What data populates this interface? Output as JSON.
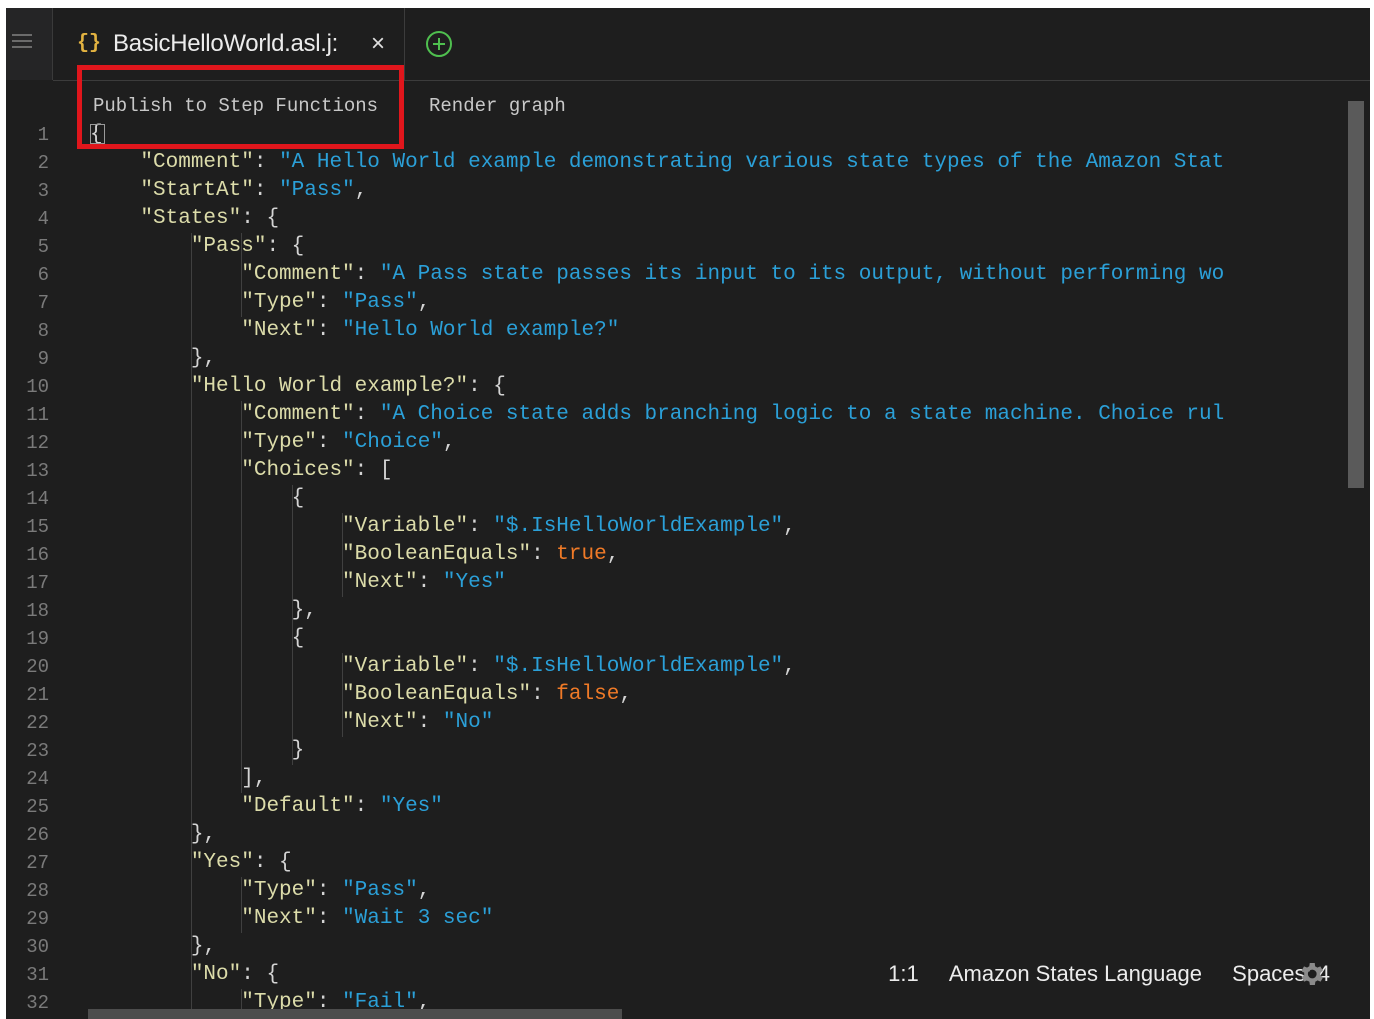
{
  "tab": {
    "icon": "{}",
    "title": "BasicHelloWorld.asl.j:",
    "close": "×"
  },
  "codelens": {
    "publish": "Publish to Step Functions",
    "render": "Render graph"
  },
  "line_numbers": [
    "1",
    "2",
    "3",
    "4",
    "5",
    "6",
    "7",
    "8",
    "9",
    "10",
    "11",
    "12",
    "13",
    "14",
    "15",
    "16",
    "17",
    "18",
    "19",
    "20",
    "21",
    "22",
    "23",
    "24",
    "25",
    "26",
    "27",
    "28",
    "29",
    "30",
    "31",
    "32"
  ],
  "code_lines": [
    [
      {
        "t": "p",
        "v": "{"
      }
    ],
    [
      {
        "t": "p",
        "v": "    "
      },
      {
        "t": "k",
        "v": "\"Comment\""
      },
      {
        "t": "p",
        "v": ": "
      },
      {
        "t": "s",
        "v": "\"A Hello World example demonstrating various state types of the Amazon Stat"
      }
    ],
    [
      {
        "t": "p",
        "v": "    "
      },
      {
        "t": "k",
        "v": "\"StartAt\""
      },
      {
        "t": "p",
        "v": ": "
      },
      {
        "t": "s",
        "v": "\"Pass\""
      },
      {
        "t": "p",
        "v": ","
      }
    ],
    [
      {
        "t": "p",
        "v": "    "
      },
      {
        "t": "k",
        "v": "\"States\""
      },
      {
        "t": "p",
        "v": ": {"
      }
    ],
    [
      {
        "t": "p",
        "v": "        "
      },
      {
        "t": "k",
        "v": "\"Pass\""
      },
      {
        "t": "p",
        "v": ": {"
      }
    ],
    [
      {
        "t": "p",
        "v": "            "
      },
      {
        "t": "k",
        "v": "\"Comment\""
      },
      {
        "t": "p",
        "v": ": "
      },
      {
        "t": "s",
        "v": "\"A Pass state passes its input to its output, without performing wo"
      }
    ],
    [
      {
        "t": "p",
        "v": "            "
      },
      {
        "t": "k",
        "v": "\"Type\""
      },
      {
        "t": "p",
        "v": ": "
      },
      {
        "t": "s",
        "v": "\"Pass\""
      },
      {
        "t": "p",
        "v": ","
      }
    ],
    [
      {
        "t": "p",
        "v": "            "
      },
      {
        "t": "k",
        "v": "\"Next\""
      },
      {
        "t": "p",
        "v": ": "
      },
      {
        "t": "s",
        "v": "\"Hello World example?\""
      }
    ],
    [
      {
        "t": "p",
        "v": "        },"
      }
    ],
    [
      {
        "t": "p",
        "v": "        "
      },
      {
        "t": "k",
        "v": "\"Hello World example?\""
      },
      {
        "t": "p",
        "v": ": {"
      }
    ],
    [
      {
        "t": "p",
        "v": "            "
      },
      {
        "t": "k",
        "v": "\"Comment\""
      },
      {
        "t": "p",
        "v": ": "
      },
      {
        "t": "s",
        "v": "\"A Choice state adds branching logic to a state machine. Choice rul"
      }
    ],
    [
      {
        "t": "p",
        "v": "            "
      },
      {
        "t": "k",
        "v": "\"Type\""
      },
      {
        "t": "p",
        "v": ": "
      },
      {
        "t": "s",
        "v": "\"Choice\""
      },
      {
        "t": "p",
        "v": ","
      }
    ],
    [
      {
        "t": "p",
        "v": "            "
      },
      {
        "t": "k",
        "v": "\"Choices\""
      },
      {
        "t": "p",
        "v": ": ["
      }
    ],
    [
      {
        "t": "p",
        "v": "                {"
      }
    ],
    [
      {
        "t": "p",
        "v": "                    "
      },
      {
        "t": "k",
        "v": "\"Variable\""
      },
      {
        "t": "p",
        "v": ": "
      },
      {
        "t": "s",
        "v": "\"$.IsHelloWorldExample\""
      },
      {
        "t": "p",
        "v": ","
      }
    ],
    [
      {
        "t": "p",
        "v": "                    "
      },
      {
        "t": "k",
        "v": "\"BooleanEquals\""
      },
      {
        "t": "p",
        "v": ": "
      },
      {
        "t": "b",
        "v": "true"
      },
      {
        "t": "p",
        "v": ","
      }
    ],
    [
      {
        "t": "p",
        "v": "                    "
      },
      {
        "t": "k",
        "v": "\"Next\""
      },
      {
        "t": "p",
        "v": ": "
      },
      {
        "t": "s",
        "v": "\"Yes\""
      }
    ],
    [
      {
        "t": "p",
        "v": "                },"
      }
    ],
    [
      {
        "t": "p",
        "v": "                {"
      }
    ],
    [
      {
        "t": "p",
        "v": "                    "
      },
      {
        "t": "k",
        "v": "\"Variable\""
      },
      {
        "t": "p",
        "v": ": "
      },
      {
        "t": "s",
        "v": "\"$.IsHelloWorldExample\""
      },
      {
        "t": "p",
        "v": ","
      }
    ],
    [
      {
        "t": "p",
        "v": "                    "
      },
      {
        "t": "k",
        "v": "\"BooleanEquals\""
      },
      {
        "t": "p",
        "v": ": "
      },
      {
        "t": "b",
        "v": "false"
      },
      {
        "t": "p",
        "v": ","
      }
    ],
    [
      {
        "t": "p",
        "v": "                    "
      },
      {
        "t": "k",
        "v": "\"Next\""
      },
      {
        "t": "p",
        "v": ": "
      },
      {
        "t": "s",
        "v": "\"No\""
      }
    ],
    [
      {
        "t": "p",
        "v": "                }"
      }
    ],
    [
      {
        "t": "p",
        "v": "            ],"
      }
    ],
    [
      {
        "t": "p",
        "v": "            "
      },
      {
        "t": "k",
        "v": "\"Default\""
      },
      {
        "t": "p",
        "v": ": "
      },
      {
        "t": "s",
        "v": "\"Yes\""
      }
    ],
    [
      {
        "t": "p",
        "v": "        },"
      }
    ],
    [
      {
        "t": "p",
        "v": "        "
      },
      {
        "t": "k",
        "v": "\"Yes\""
      },
      {
        "t": "p",
        "v": ": {"
      }
    ],
    [
      {
        "t": "p",
        "v": "            "
      },
      {
        "t": "k",
        "v": "\"Type\""
      },
      {
        "t": "p",
        "v": ": "
      },
      {
        "t": "s",
        "v": "\"Pass\""
      },
      {
        "t": "p",
        "v": ","
      }
    ],
    [
      {
        "t": "p",
        "v": "            "
      },
      {
        "t": "k",
        "v": "\"Next\""
      },
      {
        "t": "p",
        "v": ": "
      },
      {
        "t": "s",
        "v": "\"Wait 3 sec\""
      }
    ],
    [
      {
        "t": "p",
        "v": "        },"
      }
    ],
    [
      {
        "t": "p",
        "v": "        "
      },
      {
        "t": "k",
        "v": "\"No\""
      },
      {
        "t": "p",
        "v": ": {"
      }
    ],
    [
      {
        "t": "p",
        "v": "            "
      },
      {
        "t": "k",
        "v": "\"Type\""
      },
      {
        "t": "p",
        "v": ": "
      },
      {
        "t": "s",
        "v": "\"Fail\""
      },
      {
        "t": "p",
        "v": ","
      }
    ]
  ],
  "status": {
    "position": "1:1",
    "language": "Amazon States Language",
    "spaces": "Spaces: 4"
  },
  "colors": {
    "key": "#dcdcaa",
    "string": "#2ba0d8",
    "boolean": "#f07a27",
    "highlight": "#e0161c",
    "add_tab": "#4fbf4f"
  }
}
